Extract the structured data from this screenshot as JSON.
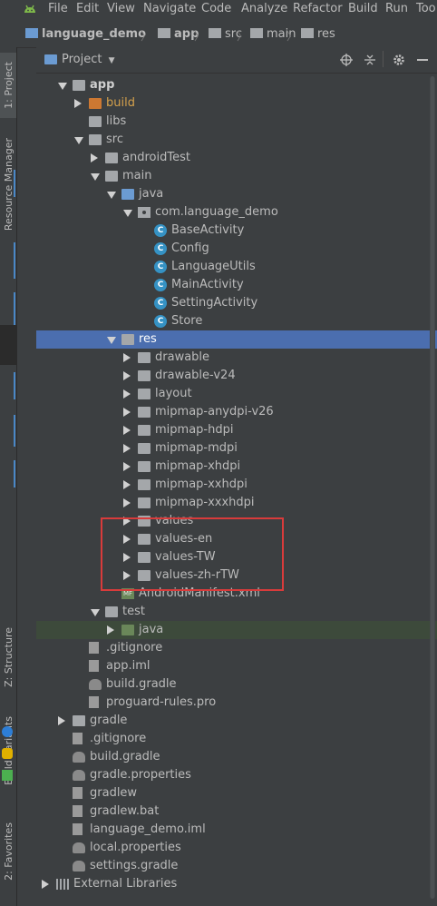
{
  "menu": [
    "File",
    "Edit",
    "View",
    "Navigate",
    "Code",
    "Analyze",
    "Refactor",
    "Build",
    "Run",
    "Too"
  ],
  "breadcrumbs": [
    "language_demo",
    "app",
    "src",
    "main",
    "res"
  ],
  "left_tabs": {
    "project": "1: Project",
    "resource_manager": "Resource Manager",
    "structure": "Z: Structure",
    "build_variants": "Build Variants",
    "favorites": "2: Favorites"
  },
  "project_panel": {
    "view": "Project"
  },
  "tree": [
    {
      "label": "app",
      "depth": 1,
      "state": "open",
      "icon": "module-folder",
      "bold": true
    },
    {
      "label": "build",
      "depth": 2,
      "state": "closed",
      "icon": "folder-orange"
    },
    {
      "label": "libs",
      "depth": 2,
      "state": "none",
      "icon": "folder"
    },
    {
      "label": "src",
      "depth": 2,
      "state": "open",
      "icon": "folder"
    },
    {
      "label": "androidTest",
      "depth": 3,
      "state": "closed",
      "icon": "folder"
    },
    {
      "label": "main",
      "depth": 3,
      "state": "open",
      "icon": "folder"
    },
    {
      "label": "java",
      "depth": 4,
      "state": "open",
      "icon": "folder-blue"
    },
    {
      "label": "com.language_demo",
      "depth": 5,
      "state": "open",
      "icon": "package"
    },
    {
      "label": "BaseActivity",
      "depth": 6,
      "state": "none",
      "icon": "class"
    },
    {
      "label": "Config",
      "depth": 6,
      "state": "none",
      "icon": "class"
    },
    {
      "label": "LanguageUtils",
      "depth": 6,
      "state": "none",
      "icon": "class"
    },
    {
      "label": "MainActivity",
      "depth": 6,
      "state": "none",
      "icon": "class"
    },
    {
      "label": "SettingActivity",
      "depth": 6,
      "state": "none",
      "icon": "class"
    },
    {
      "label": "Store",
      "depth": 6,
      "state": "none",
      "icon": "class"
    },
    {
      "label": "res",
      "depth": 4,
      "state": "open",
      "icon": "folder-res",
      "selected": true
    },
    {
      "label": "drawable",
      "depth": 5,
      "state": "closed",
      "icon": "folder"
    },
    {
      "label": "drawable-v24",
      "depth": 5,
      "state": "closed",
      "icon": "folder"
    },
    {
      "label": "layout",
      "depth": 5,
      "state": "closed",
      "icon": "folder"
    },
    {
      "label": "mipmap-anydpi-v26",
      "depth": 5,
      "state": "closed",
      "icon": "folder"
    },
    {
      "label": "mipmap-hdpi",
      "depth": 5,
      "state": "closed",
      "icon": "folder"
    },
    {
      "label": "mipmap-mdpi",
      "depth": 5,
      "state": "closed",
      "icon": "folder"
    },
    {
      "label": "mipmap-xhdpi",
      "depth": 5,
      "state": "closed",
      "icon": "folder"
    },
    {
      "label": "mipmap-xxhdpi",
      "depth": 5,
      "state": "closed",
      "icon": "folder"
    },
    {
      "label": "mipmap-xxxhdpi",
      "depth": 5,
      "state": "closed",
      "icon": "folder"
    },
    {
      "label": "values",
      "depth": 5,
      "state": "closed",
      "icon": "folder"
    },
    {
      "label": "values-en",
      "depth": 5,
      "state": "closed",
      "icon": "folder"
    },
    {
      "label": "values-TW",
      "depth": 5,
      "state": "closed",
      "icon": "folder"
    },
    {
      "label": "values-zh-rTW",
      "depth": 5,
      "state": "closed",
      "icon": "folder"
    },
    {
      "label": "AndroidManifest.xml",
      "depth": 4,
      "state": "none",
      "icon": "manifest"
    },
    {
      "label": "test",
      "depth": 3,
      "state": "open",
      "icon": "folder"
    },
    {
      "label": "java",
      "depth": 4,
      "state": "closed",
      "icon": "folder-green",
      "highlighted": true
    },
    {
      "label": ".gitignore",
      "depth": 2,
      "state": "none",
      "icon": "file"
    },
    {
      "label": "app.iml",
      "depth": 2,
      "state": "none",
      "icon": "file"
    },
    {
      "label": "build.gradle",
      "depth": 2,
      "state": "none",
      "icon": "gradle"
    },
    {
      "label": "proguard-rules.pro",
      "depth": 2,
      "state": "none",
      "icon": "file"
    },
    {
      "label": "gradle",
      "depth": 1,
      "state": "closed",
      "icon": "folder"
    },
    {
      "label": ".gitignore",
      "depth": 1,
      "state": "none",
      "icon": "file"
    },
    {
      "label": "build.gradle",
      "depth": 1,
      "state": "none",
      "icon": "gradle"
    },
    {
      "label": "gradle.properties",
      "depth": 1,
      "state": "none",
      "icon": "gradle"
    },
    {
      "label": "gradlew",
      "depth": 1,
      "state": "none",
      "icon": "file"
    },
    {
      "label": "gradlew.bat",
      "depth": 1,
      "state": "none",
      "icon": "file"
    },
    {
      "label": "language_demo.iml",
      "depth": 1,
      "state": "none",
      "icon": "file"
    },
    {
      "label": "local.properties",
      "depth": 1,
      "state": "none",
      "icon": "gradle"
    },
    {
      "label": "settings.gradle",
      "depth": 1,
      "state": "none",
      "icon": "gradle"
    },
    {
      "label": "External Libraries",
      "depth": 0,
      "state": "closed",
      "icon": "libraries"
    }
  ],
  "colors": {
    "background": "#3c3f41",
    "selection": "#4b6eaf",
    "highlight_red": "#d93b3b",
    "class_icon": "#3592c4"
  }
}
